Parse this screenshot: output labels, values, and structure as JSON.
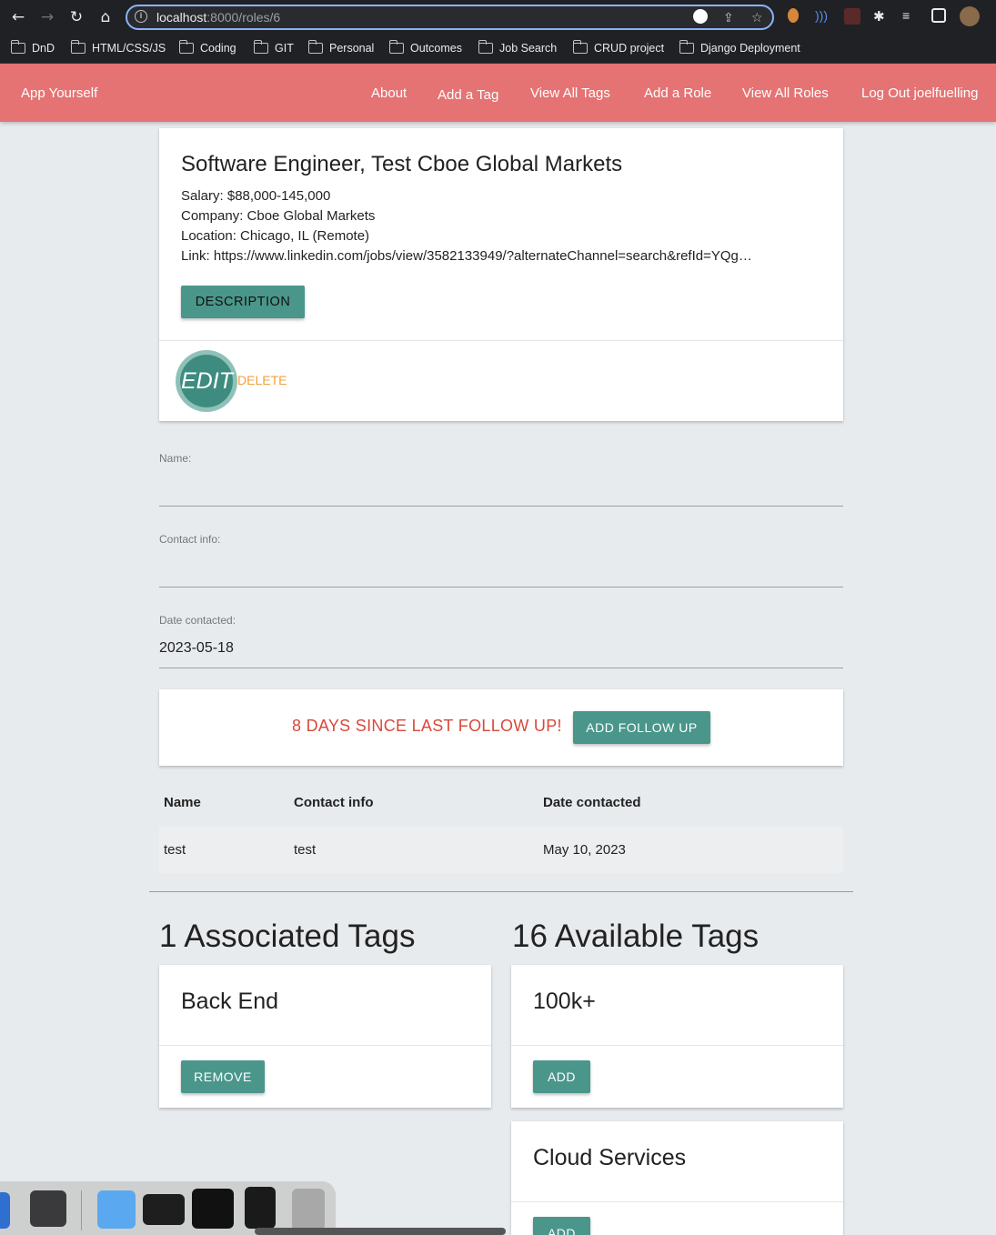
{
  "browser": {
    "url_host": "localhost",
    "url_path": ":8000/roles/6",
    "bookmarks": [
      "DnD",
      "HTML/CSS/JS",
      "Coding",
      "GIT",
      "Personal",
      "Outcomes",
      "Job Search",
      "CRUD project",
      "Django Deployment"
    ]
  },
  "navbar": {
    "brand": "App Yourself",
    "links": [
      "About",
      "Add a Tag",
      "View All Tags",
      "Add a Role",
      "View All Roles",
      "Log Out joelfuelling"
    ]
  },
  "role": {
    "title": "Software Engineer, Test Cboe Global Markets",
    "salary": "Salary: $88,000-145,000",
    "company": "Company: Cboe Global Markets",
    "location": "Location: Chicago, IL (Remote)",
    "link": "Link: https://www.linkedin.com/jobs/view/3582133949/?alternateChannel=search&refId=YQg…",
    "description_button": "DESCRIPTION",
    "edit_label": "EDIT",
    "delete_label": "DELETE"
  },
  "form": {
    "name_label": "Name:",
    "name_value": "",
    "contact_label": "Contact info:",
    "contact_value": "",
    "date_label": "Date contacted:",
    "date_value": "2023-05-18"
  },
  "followup": {
    "message": "8 DAYS SINCE LAST FOLLOW UP!",
    "button": "ADD FOLLOW UP"
  },
  "contacts_table": {
    "headers": [
      "Name",
      "Contact info",
      "Date contacted"
    ],
    "rows": [
      [
        "test",
        "test",
        "May 10, 2023"
      ]
    ]
  },
  "associated": {
    "heading": "1 Associated Tags",
    "tags": [
      {
        "name": "Back End",
        "button": "REMOVE"
      }
    ]
  },
  "available": {
    "heading": "16 Available Tags",
    "tags": [
      {
        "name": "100k+",
        "button": "ADD"
      },
      {
        "name": "Cloud Services",
        "button": "ADD"
      }
    ]
  },
  "colors": {
    "navbar": "#e57373",
    "button": "#4a968b",
    "alert": "#d9483b",
    "delete": "#f0a13e"
  }
}
